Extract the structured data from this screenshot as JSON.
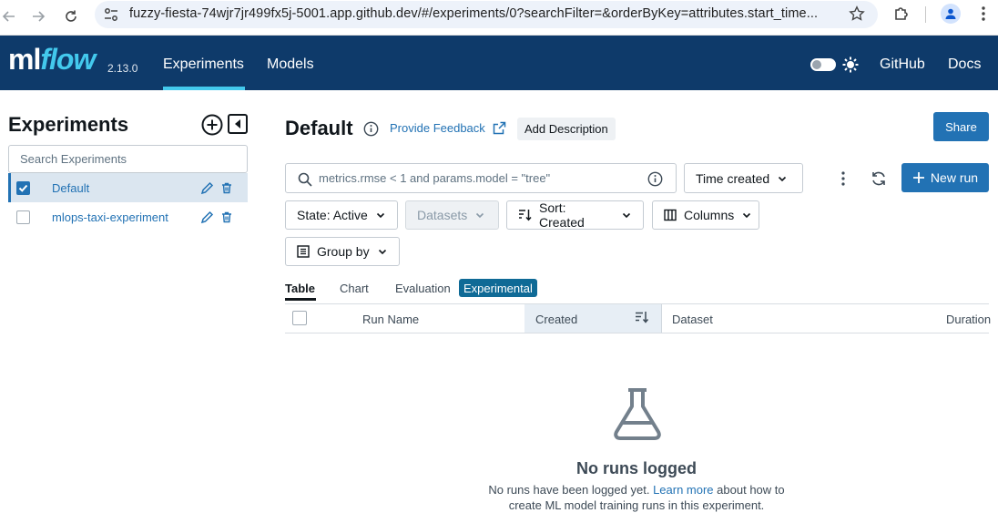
{
  "browser": {
    "url": "fuzzy-fiesta-74wjr7jr499fx5j-5001.app.github.dev/#/experiments/0?searchFilter=&orderByKey=attributes.start_time..."
  },
  "header": {
    "logo_ml": "ml",
    "logo_flow": "flow",
    "version": "2.13.0",
    "nav": [
      "Experiments",
      "Models"
    ],
    "links": [
      "GitHub",
      "Docs"
    ],
    "accent_color": "#43c9ed",
    "bg_color": "#0e3a6a"
  },
  "sidebar": {
    "title": "Experiments",
    "search_placeholder": "Search Experiments",
    "experiments": [
      {
        "name": "Default",
        "checked": true
      },
      {
        "name": "mlops-taxi-experiment",
        "checked": false
      }
    ]
  },
  "main": {
    "title": "Default",
    "feedback": "Provide Feedback",
    "add_description": "Add Description",
    "share": "Share",
    "search_placeholder": "metrics.rmse < 1 and params.model = \"tree\"",
    "time_created": "Time created",
    "new_run": "New run",
    "state": "State: Active",
    "datasets": "Datasets",
    "sort": "Sort: Created",
    "columns": "Columns",
    "group_by": "Group by",
    "tabs": [
      "Table",
      "Chart",
      "Evaluation"
    ],
    "experimental_badge": "Experimental",
    "columns_header": [
      "Run Name",
      "Created",
      "Dataset",
      "Duration"
    ],
    "empty_title": "No runs logged",
    "empty_text_before": "No runs have been logged yet.",
    "empty_link": "Learn more",
    "empty_text_after": "about how to",
    "empty_text_line2": "create ML model training runs in this experiment."
  }
}
